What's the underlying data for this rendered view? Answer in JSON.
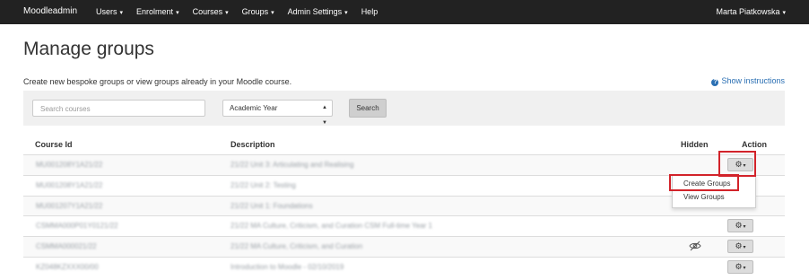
{
  "navbar": {
    "brand": "Moodleadmin",
    "menu": [
      {
        "label": "Users",
        "caret": "▾"
      },
      {
        "label": "Enrolment",
        "caret": "▾"
      },
      {
        "label": "Courses",
        "caret": "▾"
      },
      {
        "label": "Groups",
        "caret": "▾"
      },
      {
        "label": "Admin Settings",
        "caret": "▾"
      },
      {
        "label": "Help",
        "caret": ""
      }
    ],
    "user": "Marta Piatkowska",
    "user_caret": "▾"
  },
  "page": {
    "title": "Manage groups",
    "subtitle": "Create new bespoke groups or view groups already in your Moodle course.",
    "instructions_icon": "?",
    "instructions_label": "Show instructions"
  },
  "filters": {
    "search_placeholder": "Search courses",
    "academic_year": "Academic Year",
    "search_button": "Search"
  },
  "table": {
    "headers": {
      "course_id": "Course Id",
      "description": "Description",
      "hidden": "Hidden",
      "action": "Action"
    },
    "rows": [
      {
        "course_id": "MU001208Y1A21/22",
        "description": "21/22 Unit 3: Articulating and Realising",
        "hidden": false
      },
      {
        "course_id": "MU001208Y1A21/22",
        "description": "21/22 Unit 2: Testing",
        "hidden": false
      },
      {
        "course_id": "MU001207Y1A21/22",
        "description": "21/22 Unit 1: Foundations",
        "hidden": false
      },
      {
        "course_id": "CSMMA000P01Y0121/22",
        "description": "21/22 MA Culture, Criticism, and Curation CSM Full-time Year 1",
        "hidden": false
      },
      {
        "course_id": "CSMMA000021/22",
        "description": "21/22 MA Culture, Criticism, and Curation",
        "hidden": true
      },
      {
        "course_id": "KZ048KZXXX00/00",
        "description": "Introduction to Moodle - 02/10/2019",
        "hidden": false
      }
    ],
    "action_button_icon": "⚙",
    "action_button_caret": "▾"
  },
  "dropdown": {
    "options": [
      "Create Groups",
      "View Groups"
    ]
  },
  "colors": {
    "navbar_bg": "#222222",
    "link_blue": "#2a6fb3",
    "highlight_red": "#d2232a"
  }
}
